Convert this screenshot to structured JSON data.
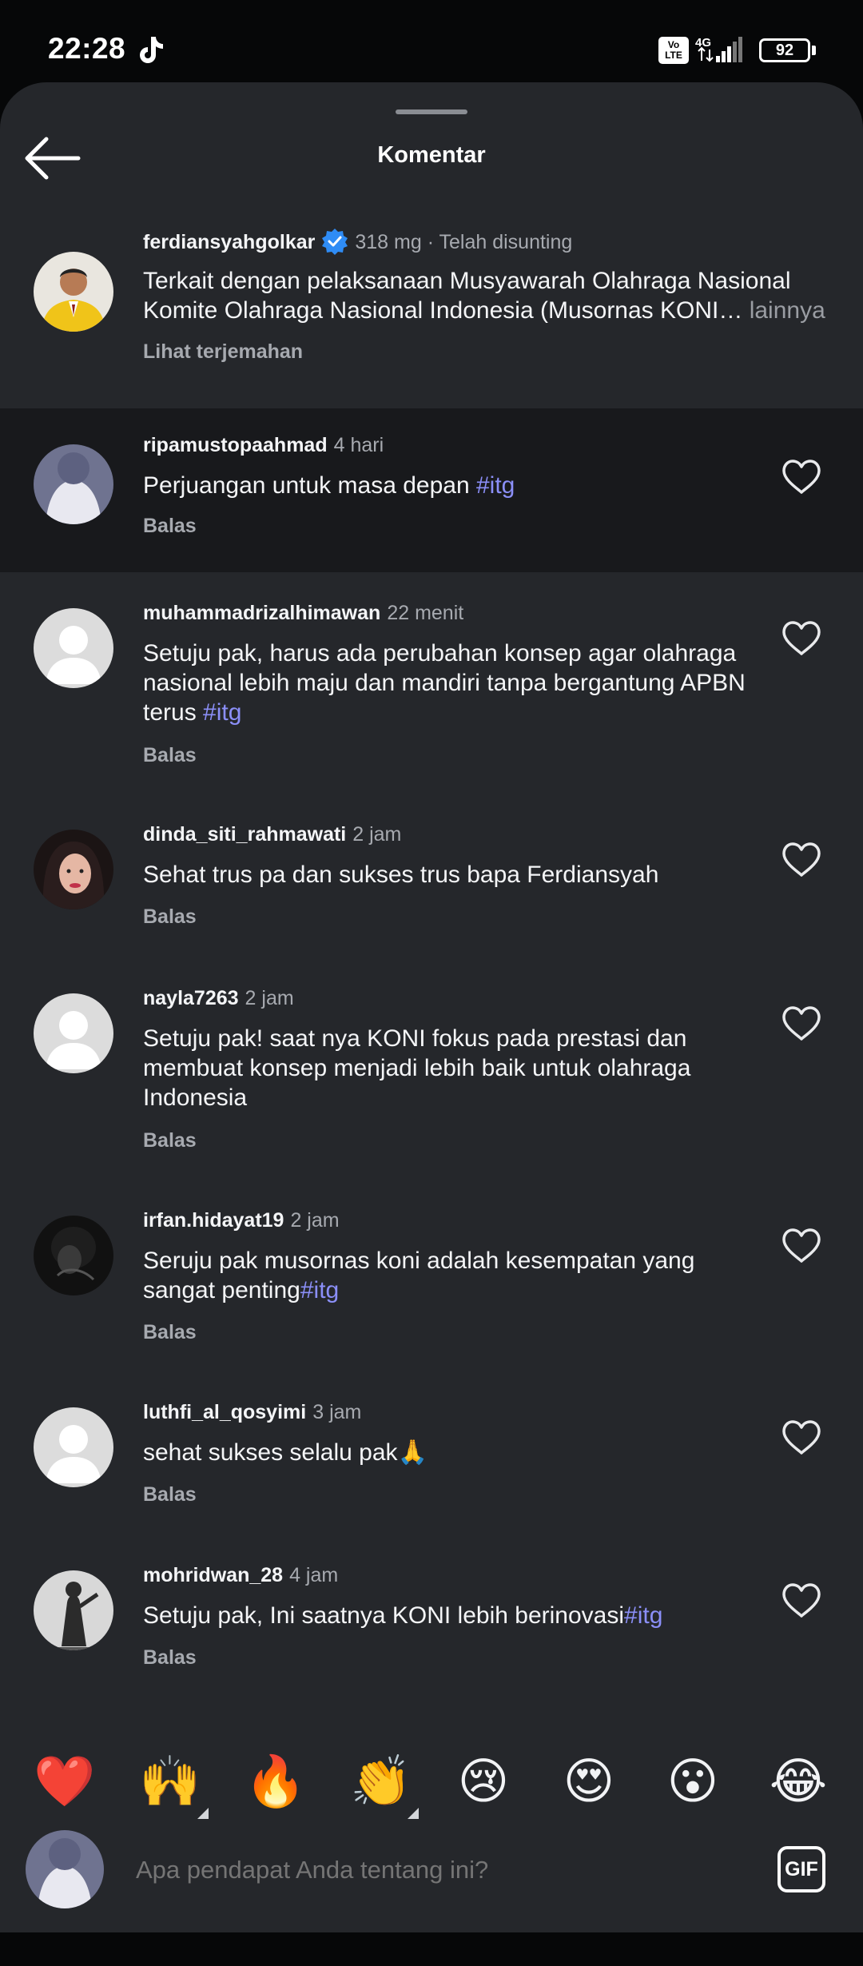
{
  "status_bar": {
    "time": "22:28",
    "network_type": "4G",
    "volte": "Vo LTE",
    "battery_percent": "92"
  },
  "header": {
    "title": "Komentar",
    "back_icon": "arrow-left-icon"
  },
  "caption": {
    "username": "ferdiansyahgolkar",
    "verified": true,
    "time": "318 mg · Telah disunting",
    "text_line1": "Terkait dengan pelaksanaan Musyawarah Olahraga Nasional",
    "text_line2": "Komite Olahraga Nasional Indonesia (Musornas KONI…",
    "more_label": " lainnya",
    "translate_label": "Lihat terjemahan",
    "avatar_icon": "profile-photo-man-yellow-jacket"
  },
  "comments": [
    {
      "username": "ripamustopaahmad",
      "time": "4 hari",
      "text": "Perjuangan untuk masa depan ",
      "hashtag": "#itg",
      "reply_label": "Balas"
    },
    {
      "username": "muhammadrizalhimawan",
      "time": "22 menit",
      "text": "Setuju pak, harus ada perubahan konsep agar olahraga nasional lebih maju dan mandiri tanpa bergantung APBN terus ",
      "hashtag": "#itg",
      "reply_label": "Balas"
    },
    {
      "username": "dinda_siti_rahmawati",
      "time": "2 jam",
      "text": "Sehat trus pa dan sukses trus bapa Ferdiansyah",
      "hashtag": "",
      "reply_label": "Balas"
    },
    {
      "username": "nayla7263",
      "time": "2 jam",
      "text": "Setuju pak! saat nya KONI fokus pada prestasi dan membuat konsep menjadi lebih baik untuk olahraga Indonesia",
      "hashtag": "",
      "reply_label": "Balas"
    },
    {
      "username": "irfan.hidayat19",
      "time": "2 jam",
      "text": "Seruju pak musornas koni adalah kesempatan yang sangat penting",
      "hashtag": "#itg",
      "reply_label": "Balas"
    },
    {
      "username": "luthfi_al_qosyimi",
      "time": "3 jam",
      "text": "sehat sukses selalu pak🙏",
      "hashtag": "",
      "reply_label": "Balas"
    },
    {
      "username": "mohridwan_28",
      "time": "4 jam",
      "text": "Setuju pak, Ini saatnya KONI lebih berinovasi",
      "hashtag": "#itg",
      "reply_label": "Balas"
    }
  ],
  "quick_reactions": [
    "❤️",
    "🙌",
    "🔥",
    "👏",
    "😢",
    "😍",
    "😮",
    "😂"
  ],
  "composer": {
    "placeholder": "Apa pendapat Anda tentang ini?",
    "gif_label": "GIF"
  },
  "colors": {
    "background": "#25272b",
    "highlight_row": "#18191c",
    "hashtag": "#8b8ff8",
    "secondary_text": "#a7aab0",
    "verified_badge": "#2f8cf5"
  }
}
